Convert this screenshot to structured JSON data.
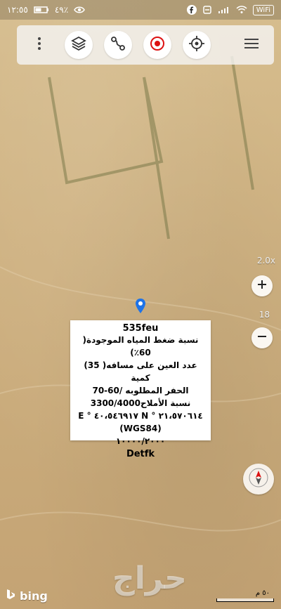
{
  "status": {
    "time": "١٢:٥٥",
    "battery_pct": "٤٩٪",
    "network_badge": "WiFi",
    "colors": {
      "text": "#ffffff"
    }
  },
  "toolbar": {
    "buttons": [
      {
        "name": "more-icon"
      },
      {
        "name": "layers-icon"
      },
      {
        "name": "route-icon"
      },
      {
        "name": "record-icon"
      },
      {
        "name": "locate-icon"
      },
      {
        "name": "menu-icon"
      }
    ]
  },
  "map": {
    "zoom_text": "2.0x",
    "zoom_level": "18",
    "compass_icon": "compass-icon"
  },
  "popup": {
    "title": "535feu",
    "lines": [
      "نسبة ضغط المياه الموجودة( 60٪)",
      "عدد العين على مسافه( 35) كمية",
      "الحفر المطلوبه /60-70",
      "نسبة الأملاح3300/4000",
      "٢١،٥٧٠٦١٤ ° N ٤٠،٥٤٦٩١٧ ° E",
      "(WGS84)",
      "١٠٠٠٠/٢٠٠٠"
    ],
    "footer": "Detfk"
  },
  "attribution": {
    "bing": "bing",
    "scale_label": "٥٠ م",
    "watermark": "حراج"
  }
}
